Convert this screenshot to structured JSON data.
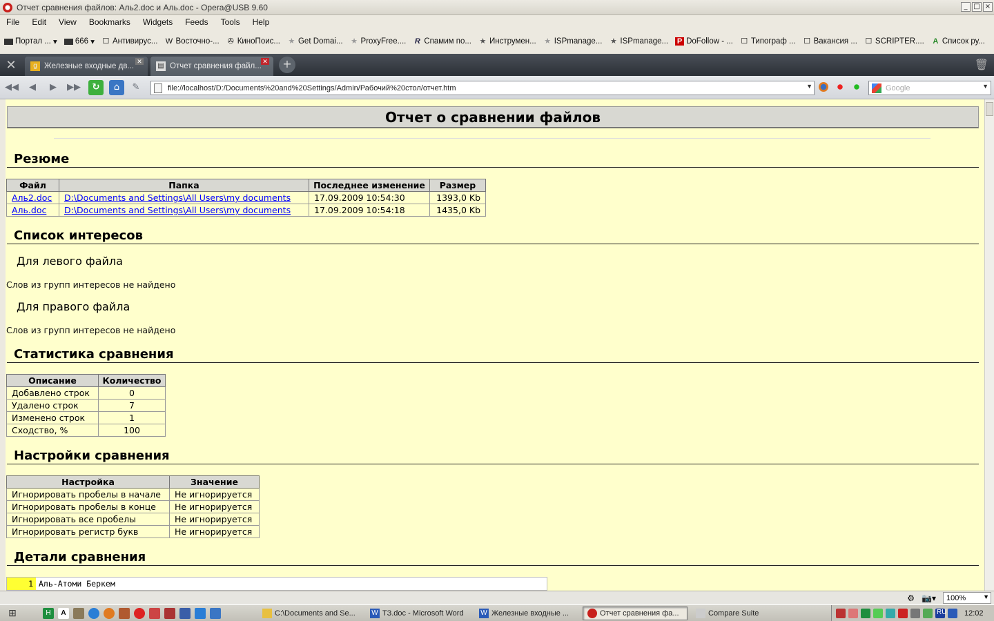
{
  "window": {
    "title": "Отчет сравнения файлов: Аль2.doc и Аль.doc - Opera@USB 9.60",
    "min": "_",
    "max": "□",
    "close": "×"
  },
  "menu": [
    "File",
    "Edit",
    "View",
    "Bookmarks",
    "Widgets",
    "Feeds",
    "Tools",
    "Help"
  ],
  "bookmarks": [
    {
      "label": "Портал ...",
      "icon": "folder-icon"
    },
    {
      "label": "666",
      "icon": "folder-icon"
    },
    {
      "label": "Антивирус...",
      "icon": "page-icon"
    },
    {
      "label": "Восточно-...",
      "icon": "wikipedia-icon"
    },
    {
      "label": "КиноПоис...",
      "icon": "film-icon"
    },
    {
      "label": "Get Domai...",
      "icon": "star-icon"
    },
    {
      "label": "ProxyFree....",
      "icon": "star-icon"
    },
    {
      "label": "Спамим по...",
      "icon": "r-icon"
    },
    {
      "label": "Инструмен...",
      "icon": "star-icon"
    },
    {
      "label": "ISPmanage...",
      "icon": "star-icon"
    },
    {
      "label": "ISPmanage...",
      "icon": "star-icon"
    },
    {
      "label": "DoFollow - ...",
      "icon": "p-icon"
    },
    {
      "label": "Типограф ...",
      "icon": "page-icon"
    },
    {
      "label": "Вакансия ...",
      "icon": "page-icon"
    },
    {
      "label": "SCRIPTER....",
      "icon": "page-icon"
    },
    {
      "label": "Список ру...",
      "icon": "a-icon"
    }
  ],
  "tabs": [
    {
      "label": "Железные входные дв...",
      "active": false
    },
    {
      "label": "Отчет сравнения файл...",
      "active": true
    }
  ],
  "address": {
    "url": "file://localhost/D:/Documents%20and%20Settings/Admin/Рабочий%20стол/отчет.htm",
    "search_placeholder": "Google"
  },
  "report": {
    "title": "Отчет о сравнении файлов",
    "summary": {
      "heading": "Резюме",
      "columns": [
        "Файл",
        "Папка",
        "Последнее изменение",
        "Размер"
      ],
      "rows": [
        [
          "Аль2.doc",
          "D:\\Documents and Settings\\All Users\\my documents",
          "17.09.2009 10:54:30",
          "1393,0 Kb"
        ],
        [
          "Аль.doc",
          "D:\\Documents and Settings\\All Users\\my documents",
          "17.09.2009 10:54:18",
          "1435,0 Kb"
        ]
      ]
    },
    "interests": {
      "heading": "Список интересов",
      "left_title": "Для левого файла",
      "left_text": "Слов из групп интересов не найдено",
      "right_title": "Для правого файла",
      "right_text": "Слов из групп интересов не найдено"
    },
    "stats": {
      "heading": "Статистика сравнения",
      "columns": [
        "Описание",
        "Количество"
      ],
      "rows": [
        [
          "Добавлено строк",
          "0"
        ],
        [
          "Удалено строк",
          "7"
        ],
        [
          "Изменено строк",
          "1"
        ],
        [
          "Сходство, %",
          "100"
        ]
      ]
    },
    "settings": {
      "heading": "Настройки сравнения",
      "columns": [
        "Настройка",
        "Значение"
      ],
      "rows": [
        [
          "Игнорировать пробелы в начале",
          "Не игнорируется"
        ],
        [
          "Игнорировать пробелы в конце",
          "Не игнорируется"
        ],
        [
          "Игнорировать все пробелы",
          "Не игнорируется"
        ],
        [
          "Игнорировать регистр букв",
          "Не игнорируется"
        ]
      ]
    },
    "details": {
      "heading": "Детали сравнения",
      "line_no": "1",
      "line_text": "Аль-Атоми Беркем"
    }
  },
  "status": {
    "zoom": "100%"
  },
  "taskbar": {
    "tasks": [
      {
        "label": "C:\\Documents and Se...",
        "icon": "folder-icon",
        "active": false
      },
      {
        "label": "ТЗ.doc - Microsoft Word",
        "icon": "word-icon",
        "active": false
      },
      {
        "label": "Железные входные ...",
        "icon": "word-icon",
        "active": false
      },
      {
        "label": "Отчет сравнения фа...",
        "icon": "opera-icon",
        "active": true
      },
      {
        "label": "Compare Suite",
        "icon": "compare-icon",
        "active": false
      }
    ],
    "lang": "RU",
    "clock": "12:02"
  }
}
